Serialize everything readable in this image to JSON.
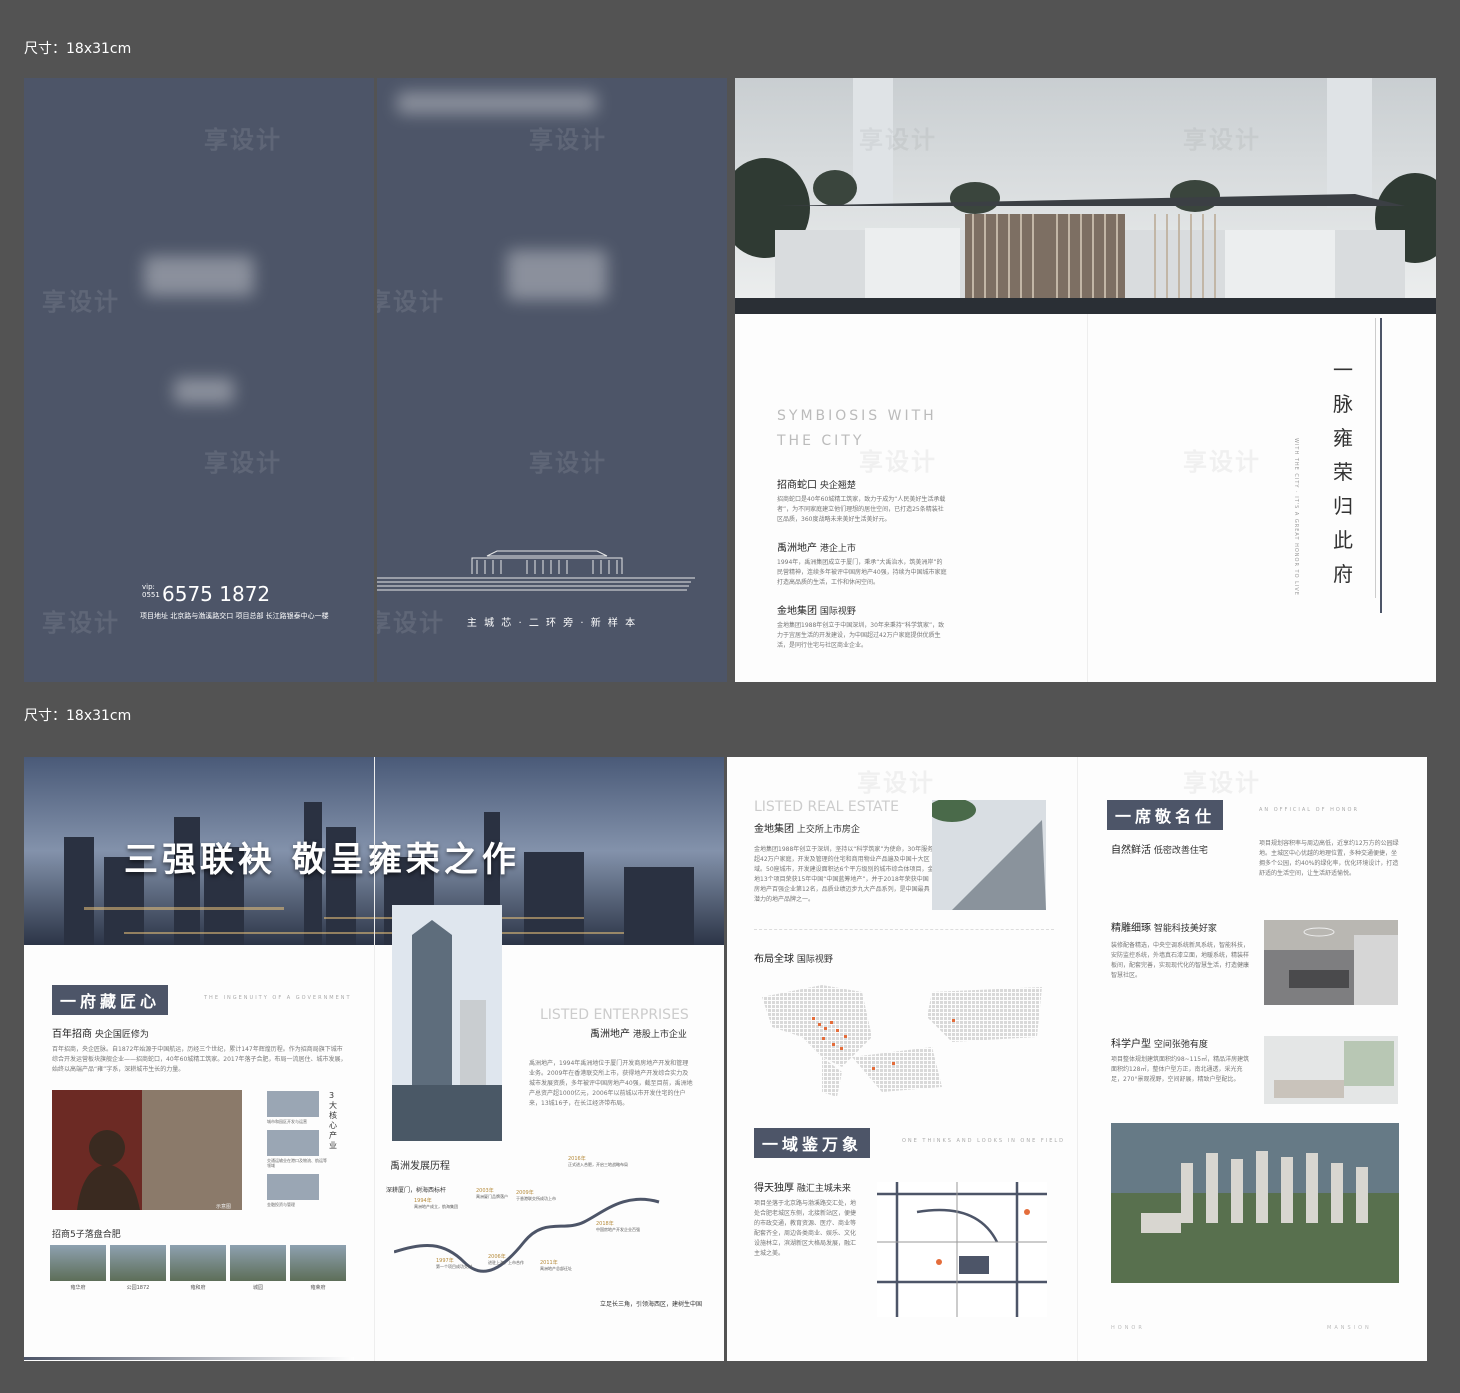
{
  "sizes": {
    "top": "尺寸：18x31cm",
    "bottom": "尺寸：18x31cm"
  },
  "watermark": "享设计",
  "cover": {
    "vip_prefix": "vip:",
    "area_code": "0551",
    "phone": "6575 1872",
    "address": "项目地址 北京路与渤溪路交口  项目总部 长江路银泰中心一楼",
    "slogan": "主 城 芯 · 二 环 旁 · 新 样 本"
  },
  "spread1": {
    "en_title_1": "SYMBIOSIS WITH",
    "en_title_2": "THE CITY",
    "vertical_title": "一脉雍荣归此府",
    "vertical_en": "WITH THE CITY · IT'S A GREAT HONOR TO LIVE",
    "sections": [
      {
        "title": "招商蛇口",
        "sub": "央企翘楚",
        "body": "招商蛇口是40年60城精工筑家，致力于成为“人民美好生活承载者”，为不同家庭建立他们理想的居住空间，已打造25条精装社区品质，360度战略未来美好生活美好元。"
      },
      {
        "title": "禹洲地产",
        "sub": "港企上市",
        "body": "1994年，禹洲集团成立于厦门，秉承“大禹治水，筑美洲岸”的民营精神，连续多年被评中国房地产40强，持续为中国城市家庭打造高品质的生活，工作和休闲空间。"
      },
      {
        "title": "金地集团",
        "sub": "国际视野",
        "body": "金地集团1988年创立于中国深圳，30年来秉持“科学筑家”，致力于宜居生活的开发建设，为中国超过42万户家庭提供优质生活，是同行住宅与社区商业企业。"
      }
    ]
  },
  "spread2": {
    "hero_title": "三强联袂 敬呈雍荣之作",
    "badge1": "一府藏匠心",
    "badge1_en": "THE INGENUITY OF A GOVERNMENT",
    "s1_title": "百年招商",
    "s1_sub": "央企国匠修为",
    "s1_body": "百年招商，央企匠脉。自1872年始源于中国航运，历经三个世纪，累计147年辉煌历程。作为招商局旗下城市综合开发运营板块旗舰企业——招商蛇口，40年60城精工筑家。2017年落子合肥，布局一流居住、城市发展，始终以高端产品“雍”字系，深耕城市生长的力量。",
    "photo_credit": "示意图",
    "core_label": "3大核心产业",
    "cores": [
      {
        "label": "城市和园区开发与运营"
      },
      {
        "label": "交通运输业在港口及物流、航运等领域"
      },
      {
        "label": "金融投资与管理"
      }
    ],
    "projects_title": "招商5子落盘合肥",
    "projects": [
      "雍华府",
      "公园1872",
      "雍和府",
      "城园",
      "雍荣府"
    ],
    "listed_en": "LISTED ENTERPRISES",
    "listed_title": "禹洲地产",
    "listed_sub": "港股上市企业",
    "listed_body": "禹洲地产，1994年禹洲地位于厦门开发商房地产开发和管理业务。2009年在香港联交所上市，获得地产开发综合实力及城市发展资质，多年被评中国房地产40强，截至目前，禹洲地产总资产超1000亿元，2006年以前城以市开发住宅的住户来，13城16子，在长江经济带布局。",
    "history_title": "禹洲发展历程",
    "history_start": "深耕厦门，树海西标杆",
    "history_end": "立足长三角，引领海西区，建树生中国",
    "history": [
      {
        "year": "1994年",
        "text": "禹洲地产成立，航海集团"
      },
      {
        "year": "1997年",
        "text": "第一个项目成功交付"
      },
      {
        "year": "2003年",
        "text": "禹洲厦门品牌落户"
      },
      {
        "year": "2006年",
        "text": "进驻上海，上市合作"
      },
      {
        "year": "2009年",
        "text": "于香港联交所成功上市"
      },
      {
        "year": "2011年",
        "text": "禹洲地产总部迁址"
      },
      {
        "year": "2016年",
        "text": "正式进入合肥，开启三地战略布局"
      },
      {
        "year": "2018年",
        "text": "中国房地产开发企业百强"
      }
    ],
    "estate_en": "LISTED REAL ESTATE",
    "estate_title": "金地集团",
    "estate_sub": "上交所上市房企",
    "estate_body": "金地集团1988年创立于深圳，坚持以“科学筑家”为使命，30年服务超42万户家庭，开发及管理的住宅和商用物业产品遍及中国十大区域。50座城市，开发建设面积达6个平方级别的城市综合体项目，金地13个项目荣获15年中国“中国蓝筹地产”，并于2018年荣获中国房地产百强企业第12名，品质业绩迈步九大产品系列，是中国最具潜力的地产品牌之一。",
    "global_title": "布局全球",
    "global_sub": "国际视野",
    "badge2": "一域鉴万象",
    "badge2_en": "ONE THINKS AND LOOKS IN ONE FIELD",
    "district_title": "得天独厚",
    "district_sub": "融汇主城未来",
    "district_body": "项目坐落于北京路与渤溪路交汇处，地处合肥老城区东侧，北接新站区，便捷的市政交通，教育资源、医疗、商业等配套齐全，周边各类商业、娱乐、文化设施林立，滨湖新区大格局发展，融汇主城之美。",
    "badge3": "一席敬名仕",
    "badge3_en": "AN OFFICIAL OF HONOR",
    "r1_title": "自然鲜活",
    "r1_sub": "低密改善住宅",
    "r1_body": "项目规划容积率与周边高低，近享约12万方的公园绿地。主城区中心优越的地理位置，多种交通便捷，坐拥多个公园，约40%的绿化率，优化环境设计，打造舒适的生活空间，让生活舒适愉悦。",
    "r2_title": "精雕细琢",
    "r2_sub": "智能科技美好家",
    "r2_body": "装修配备精选，中央空调系统新风系统，智能科技，安防监控系统，外墙真石漆立面，地暖系统，精装样板间，配套完善，实现现代化的智慧生活，打造健康智慧社区。",
    "r3_title": "科学户型",
    "r3_sub": "空间张弛有度",
    "r3_body": "项目整体规划建筑面积约98~115㎡，精品洋房建筑面积约128㎡，整体户型方正，南北通透，采光充足，270°景观视野，空间舒展，精致户型配比。",
    "footer_l": "HONOR",
    "footer_r": "MANSION"
  }
}
